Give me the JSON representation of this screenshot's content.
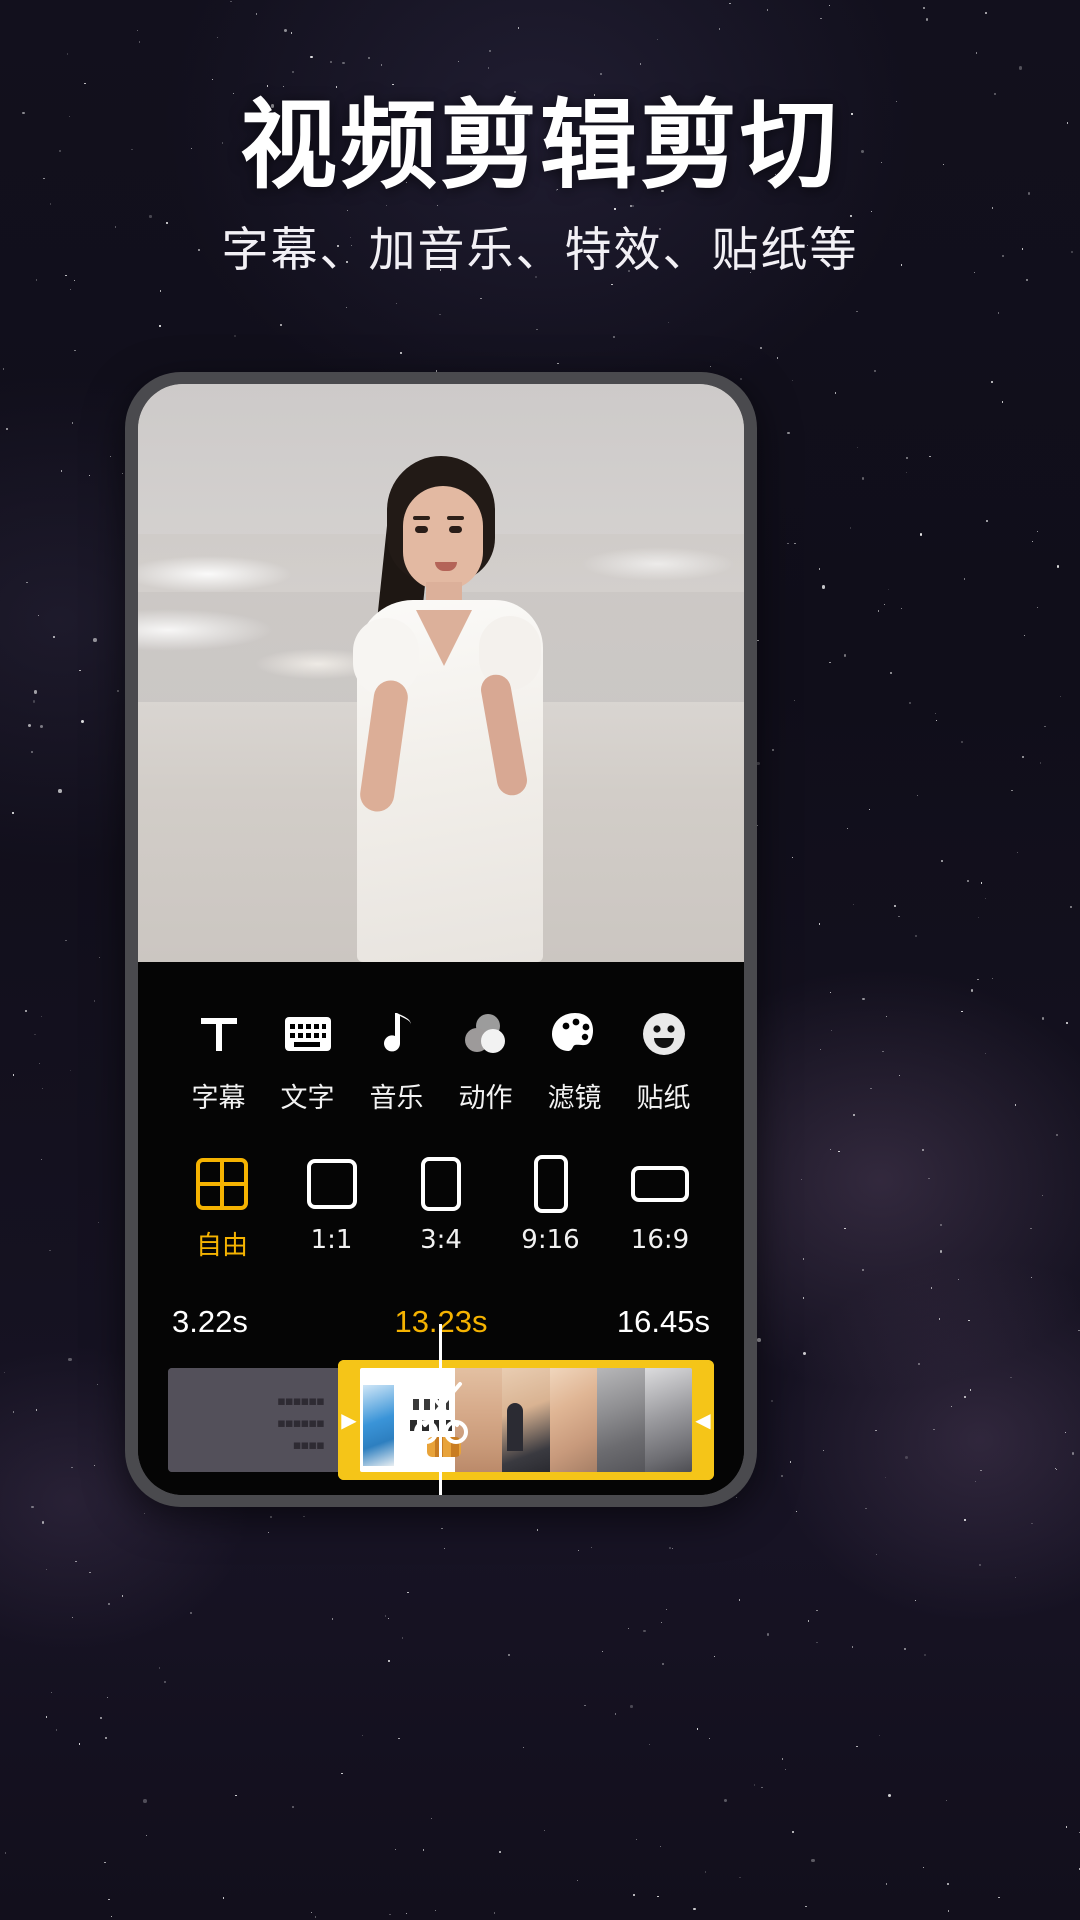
{
  "hero": {
    "title": "视频剪辑剪切",
    "subtitle": "字幕、加音乐、特效、贴纸等"
  },
  "colors": {
    "accent": "#F5B301",
    "clip_bar": "#F5C518",
    "panel_bg": "#050505",
    "phone_frame": "#4a4a4e",
    "text": "#ffffff"
  },
  "editor": {
    "tools": [
      {
        "label": "字幕",
        "icon": "subtitle-t-icon"
      },
      {
        "label": "文字",
        "icon": "keyboard-icon"
      },
      {
        "label": "音乐",
        "icon": "music-note-icon"
      },
      {
        "label": "动作",
        "icon": "overlapping-circles-icon"
      },
      {
        "label": "滤镜",
        "icon": "palette-icon"
      },
      {
        "label": "贴纸",
        "icon": "smiley-face-icon"
      }
    ],
    "ratios": [
      {
        "label": "自由",
        "icon": "free-grid-icon",
        "selected": true
      },
      {
        "label": "1:1",
        "icon": "square-icon",
        "selected": false
      },
      {
        "label": "3:4",
        "icon": "portrait-small-icon",
        "selected": false
      },
      {
        "label": "9:16",
        "icon": "portrait-tall-icon",
        "selected": false
      },
      {
        "label": "16:9",
        "icon": "landscape-icon",
        "selected": false
      }
    ],
    "timeline": {
      "start_time": "3.22s",
      "current_time": "13.23s",
      "end_time": "16.45s",
      "left_handle": "▶",
      "right_handle": "◀",
      "cut_icon": "scissors-icon"
    }
  }
}
